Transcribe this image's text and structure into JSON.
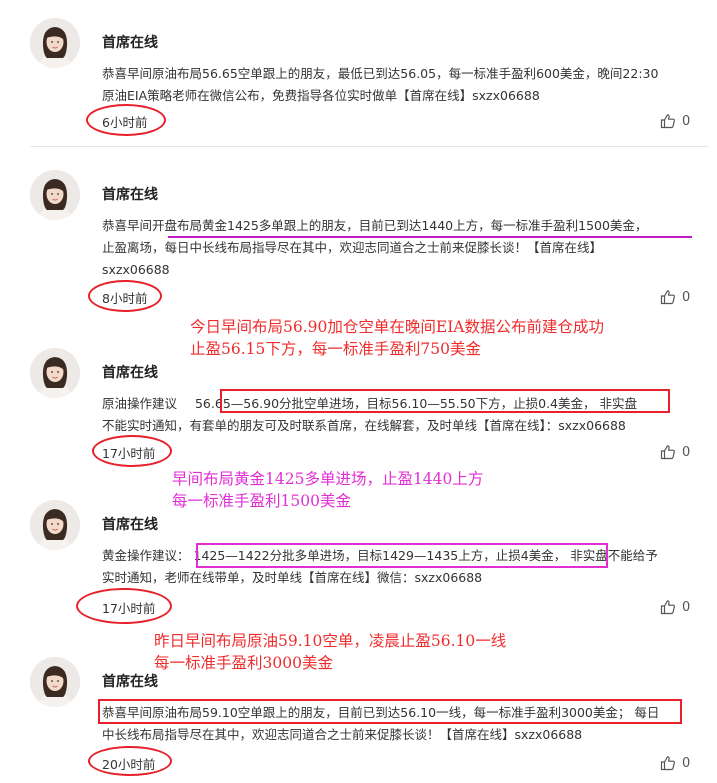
{
  "posts": [
    {
      "author": "首席在线",
      "lines": [
        "恭喜早间原油布局56.65空单跟上的朋友，最低已到达56.05，每一标准手盈利600美金，晚间22:30",
        "原油EIA策略老师在微信公布，免费指导各位实时做单【首席在线】sxzx06688"
      ],
      "time": "6小时前",
      "likes": "0"
    },
    {
      "author": "首席在线",
      "lines": [
        "恭喜早间开盘布局黄金1425多单跟上的朋友，目前已到达1440上方，每一标准手盈利1500美金，",
        "止盈离场，每日中长线布局指导尽在其中，欢迎志同道合之士前来促膝长谈！【首席在线】",
        "sxzx06688"
      ],
      "time": "8小时前",
      "likes": "0"
    },
    {
      "author": "首席在线",
      "line1_prefix": "原油操作建议",
      "line1_boxed": "56.65—56.90分批空单进场，目标56.10—55.50下方，止损0.4美金，",
      "line1_suffix": "非实盘",
      "lines_rest": [
        "不能实时通知，有套单的朋友可及时联系首席，在线解套，及时单线【首席在线】：sxzx06688"
      ],
      "time": "17小时前",
      "likes": "0"
    },
    {
      "author": "首席在线",
      "line1_prefix": "黄金操作建议：",
      "line1_boxed": "1425—1422分批多单进场，目标1429—1435上方，止损4美金，",
      "line1_suffix": "非实盘不能给予",
      "lines_rest": [
        "实时通知，老师在线带单，及时单线【首席在线】微信：sxzx06688"
      ],
      "time": "17小时前",
      "likes": "0"
    },
    {
      "author": "首席在线",
      "line1_boxed": "恭喜早间原油布局59.10空单跟上的朋友，目前已到达56.10一线，每一标准手盈利3000美金；",
      "line1_suffix": "每日",
      "lines_rest": [
        "中长线布局指导尽在其中，欢迎志同道合之士前来促膝长谈！【首席在线】sxzx06688"
      ],
      "time": "20小时前",
      "likes": "0"
    }
  ],
  "annotations": {
    "a1": [
      "今日早间布局56.90加仓空单在晚间EIA数据公布前建仓成功",
      "止盈56.15下方，每一标准手盈利750美金"
    ],
    "a2": [
      "早间布局黄金1425多单进场，止盈1440上方",
      "每一标准手盈利1500美金"
    ],
    "a3": [
      "昨日早间布局原油59.10空单，凌晨止盈56.10一线",
      "每一标准手盈利3000美金"
    ]
  },
  "colors": {
    "annotation_red": "#ef2d2d",
    "annotation_magenta": "#e22fd4",
    "ring": "#e8202a"
  },
  "icons": {
    "like": "thumbs-up-icon",
    "avatar": "avatar"
  }
}
